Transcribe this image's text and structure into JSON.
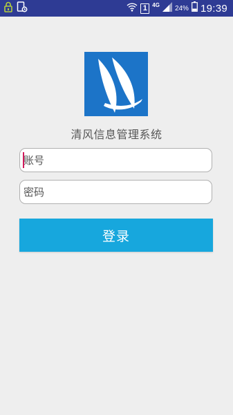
{
  "status_bar": {
    "time": "19:39",
    "battery_percent": "24%",
    "network_type": "4G",
    "sim_slot": "1",
    "icons": [
      "lock-icon",
      "app-notification-icon",
      "wifi-icon",
      "sim-1-icon",
      "cell-signal-icon",
      "battery-icon"
    ]
  },
  "logo": {
    "icon": "sailboat-logo",
    "bg_color": "#1c74c8"
  },
  "app_title": "清风信息管理系统",
  "login_form": {
    "account_placeholder": "账号",
    "password_placeholder": "密码",
    "login_label": "登录",
    "button_color": "#17a7dd"
  }
}
